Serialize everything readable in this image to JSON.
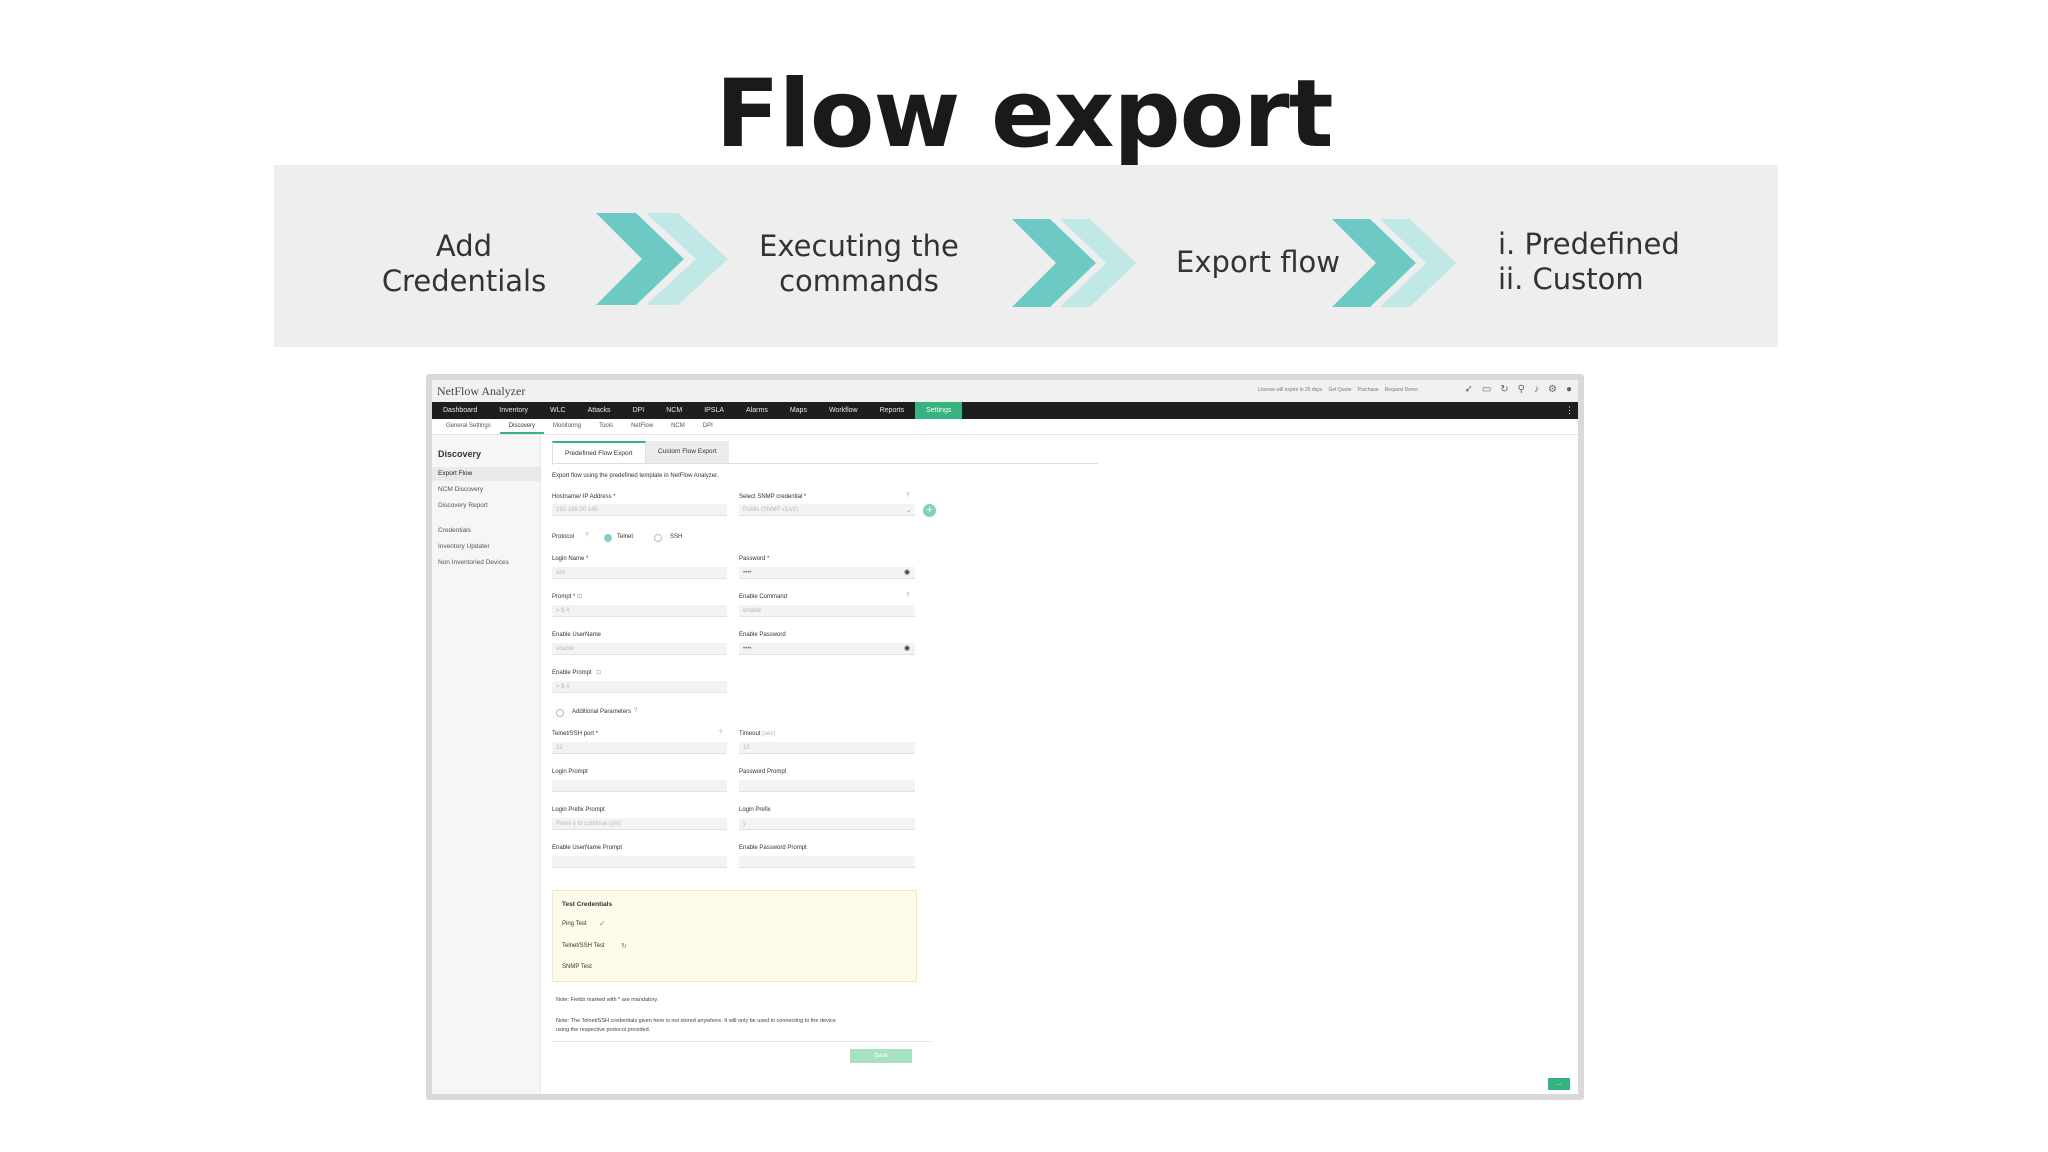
{
  "slide": {
    "title": "Flow export",
    "steps": [
      {
        "line1": "Add",
        "line2": "Credentials"
      },
      {
        "line1": "Executing the",
        "line2": "commands"
      },
      {
        "line1": "Export flow",
        "line2": ""
      },
      {
        "line1": "i. Predefined",
        "line2": "ii. Custom"
      }
    ],
    "chevron_colors": {
      "dark": "#6cc9c4",
      "light": "#bfe8e6"
    }
  },
  "app": {
    "name": "NetFlow Analyzer",
    "top_links": [
      "License will expire in 25 days",
      "Get Quote",
      "Purchase",
      "Request Demo"
    ],
    "top_icons": [
      "rocket-icon",
      "monitor-icon",
      "refresh-icon",
      "search-icon",
      "bell-icon",
      "gear-icon",
      "user-icon"
    ],
    "main_nav": [
      "Dashboard",
      "Inventory",
      "WLC",
      "Attacks",
      "DPI",
      "NCM",
      "IPSLA",
      "Alarms",
      "Maps",
      "Workflow",
      "Reports",
      "Settings"
    ],
    "main_nav_active": "Settings",
    "sub_nav": [
      "General Settings",
      "Discovery",
      "Monitoring",
      "Tools",
      "NetFlow",
      "NCM",
      "DPI"
    ],
    "sub_nav_active": "Discovery",
    "accent": "#36b37e"
  },
  "sidebar": {
    "heading": "Discovery",
    "items": [
      "Export Flow",
      "NCM Discovery",
      "Discovery Report",
      "Credentials",
      "Inventory Updater",
      "Non Inventoried Devices"
    ]
  },
  "form": {
    "tabs": [
      "Predefined Flow Export",
      "Custom Flow Export"
    ],
    "description": "Export flow using the predefined template in NetFlow Analyzer.",
    "hostname_label": "Hostname/ IP Address *",
    "hostname_placeholder": "192.168.50.145",
    "snmp_label": "Select SNMP credential *",
    "snmp_value": "Public (SNMP v1/v2)",
    "protocol_label": "Protocol",
    "protocol_telnet": "Telnet",
    "protocol_ssh": "SSH",
    "login_name_label": "Login Name *",
    "login_name_placeholder": "abc",
    "password_label": "Password *",
    "password_value": "••••",
    "prompt_label": "Prompt *",
    "prompt_placeholder": "> $ #",
    "enable_command_label": "Enable Command",
    "enable_command_placeholder": "enable",
    "enable_username_label": "Enable UserName",
    "enable_username_placeholder": "enable",
    "enable_password_label": "Enable Password",
    "enable_password_value": "••••",
    "enable_prompt_label": "Enable Prompt",
    "enable_prompt_placeholder": "> $ #",
    "additional_params_label": "Additional Parameters",
    "port_label": "Telnet/SSH port *",
    "port_placeholder": "22",
    "timeout_label": "Timeout",
    "timeout_unit": "(sec)",
    "timeout_placeholder": "10",
    "login_prompt_label": "Login Prompt",
    "password_prompt_label": "Password Prompt",
    "login_prefix_prompt_label": "Login Prefix Prompt",
    "login_prefix_prompt_placeholder": "Press y to continue (y/n)",
    "login_prefix_label": "Login Prefix",
    "login_prefix_placeholder": "y",
    "enable_username_prompt_label": "Enable UserName Prompt",
    "enable_password_prompt_label": "Enable Password Prompt",
    "test_heading": "Test Credentials",
    "test_items": [
      "Ping Test",
      "Telnet/SSH Test",
      "SNMP Test"
    ],
    "note1": "Note: Fields marked with * are mandatory.",
    "note2": "Note: The Telnet/SSH credentials given here is not stored anywhere. It will only be used in connecting to the device",
    "note3": "using the respective protocol provided.",
    "save_label": "Save",
    "corner_label": "..."
  }
}
